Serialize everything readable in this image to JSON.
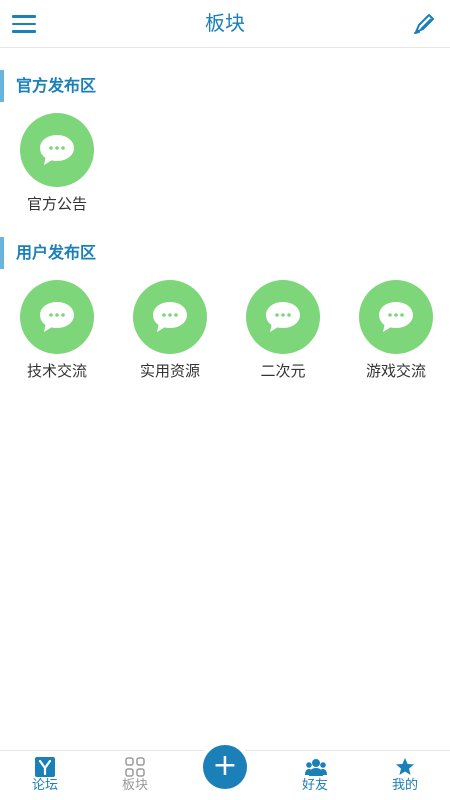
{
  "header": {
    "title": "板块",
    "menu_icon": "hamburger-menu-icon",
    "edit_icon": "pen-edit-icon"
  },
  "sections": [
    {
      "title": "官方发布区",
      "boards": [
        {
          "name": "官方公告",
          "icon": "chat-bubble-icon"
        }
      ]
    },
    {
      "title": "用户发布区",
      "boards": [
        {
          "name": "技术交流",
          "icon": "chat-bubble-icon"
        },
        {
          "name": "实用资源",
          "icon": "chat-bubble-icon"
        },
        {
          "name": "二次元",
          "icon": "chat-bubble-icon"
        },
        {
          "name": "游戏交流",
          "icon": "chat-bubble-icon"
        }
      ]
    }
  ],
  "tabbar": {
    "items": [
      {
        "label": "论坛",
        "icon": "forum-y-icon",
        "active": true
      },
      {
        "label": "板块",
        "icon": "grid-icon",
        "active": false
      },
      {
        "label": "+",
        "icon": "plus-icon"
      },
      {
        "label": "好友",
        "icon": "friends-icon",
        "active": true
      },
      {
        "label": "我的",
        "icon": "star-icon",
        "active": true
      }
    ]
  },
  "colors": {
    "accent": "#1b7fb8",
    "section_bar": "#6ab3dc",
    "board_icon_bg": "#7ed67a",
    "inactive": "#9a9a9a"
  }
}
